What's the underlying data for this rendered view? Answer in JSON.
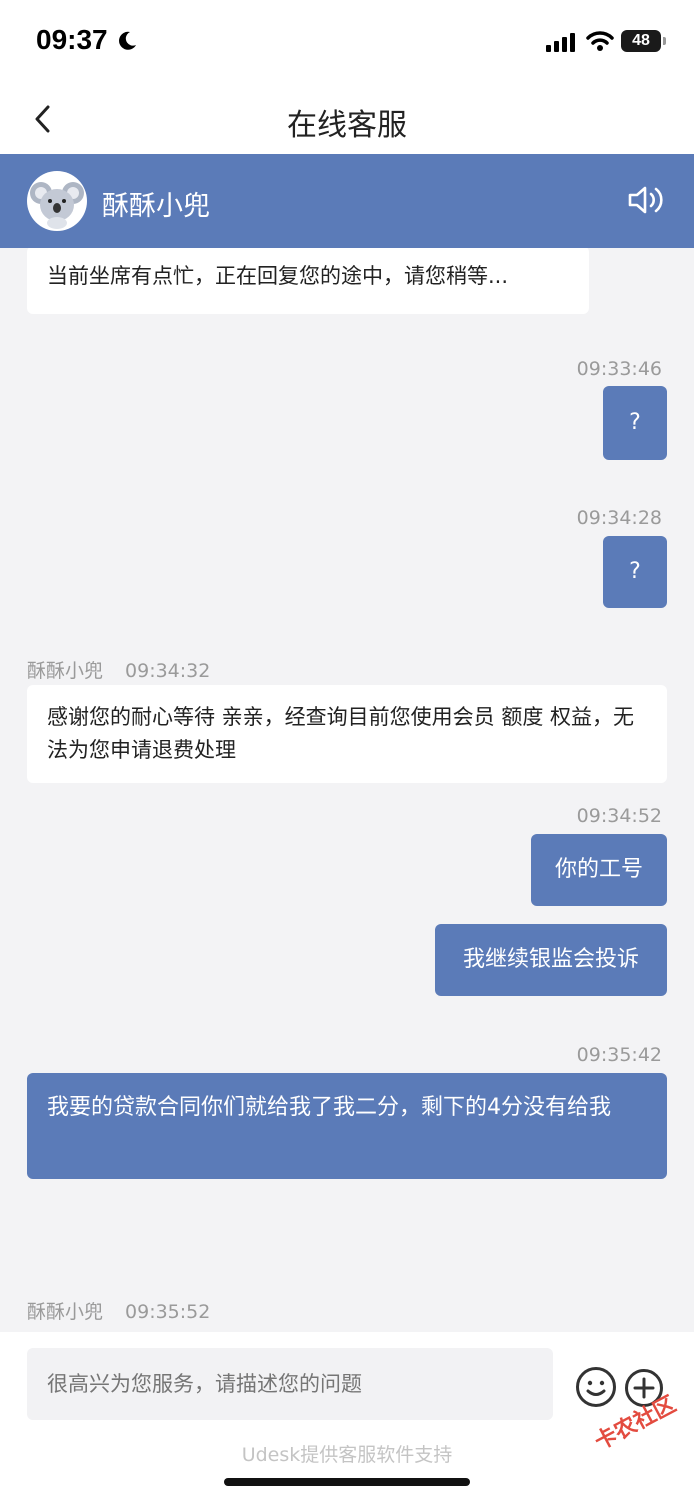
{
  "status_bar": {
    "time": "09:37",
    "battery": "48"
  },
  "nav": {
    "title": "在线客服"
  },
  "header": {
    "agent_name": "酥酥小兜"
  },
  "messages": {
    "m1_text": "当前坐席有点忙，正在回复您的途中，请您稍等...",
    "m2_time": "09:33:46",
    "m2_text": "?",
    "m3_time": "09:34:28",
    "m3_text": "?",
    "m4_sender": "酥酥小兜",
    "m4_time": "09:34:32",
    "m4_text": "感谢您的耐心等待 亲亲，经查询目前您使用会员 额度 权益，无法为您申请退费处理",
    "m5_time": "09:34:52",
    "m5_text": "你的工号",
    "m6_text": "我继续银监会投诉",
    "m7_time": "09:35:42",
    "m7_text": "我要的贷款合同你们就给我了我二分，剩下的4分没有给我",
    "m8_sender": "酥酥小兜",
    "m8_time": "09:35:52"
  },
  "input": {
    "placeholder": "很高兴为您服务，请描述您的问题"
  },
  "footer": {
    "powered_by": "Udesk提供客服软件支持",
    "watermark": "卡农社区"
  },
  "colors": {
    "accent": "#5b7bb8",
    "background": "#f3f3f5"
  },
  "icons": [
    "moon-icon",
    "signal-icon",
    "wifi-icon",
    "back-icon",
    "speaker-icon",
    "emoji-icon",
    "plus-icon"
  ]
}
